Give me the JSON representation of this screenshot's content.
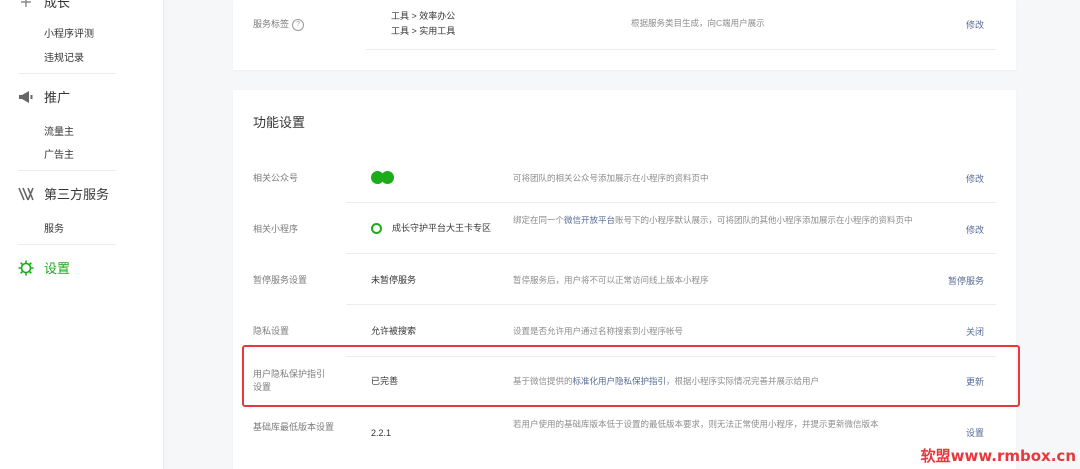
{
  "sidebar": {
    "group_growth": {
      "label": "成长",
      "items": [
        "小程序评测",
        "违规记录"
      ]
    },
    "group_promo": {
      "label": "推广",
      "items": [
        "流量主",
        "广告主"
      ]
    },
    "group_third": {
      "label": "第三方服务",
      "items": [
        "服务"
      ]
    },
    "group_settings": {
      "label": "设置"
    }
  },
  "top_card": {
    "row_label": "服务标签",
    "help": "?",
    "values": [
      "工具 > 效率办公",
      "工具 > 实用工具"
    ],
    "desc": "根据服务类目生成，向C端用户展示",
    "action": "修改"
  },
  "features": {
    "title": "功能设置",
    "rows": [
      {
        "label": "相关公众号",
        "value": "",
        "desc": "可将团队的相关公众号添加展示在小程序的资料页中",
        "action": "修改"
      },
      {
        "label": "相关小程序",
        "value": "成长守护平台大王卡专区",
        "desc_pre": "绑定在同一个",
        "desc_hl": "微信开放平台",
        "desc_post": "账号下的小程序默认展示，可将团队的其他小程序添加展示在小程序的资料页中",
        "action": "修改"
      },
      {
        "label": "暂停服务设置",
        "value": "未暂停服务",
        "desc": "暂停服务后，用户将不可以正常访问线上版本小程序",
        "action": "暂停服务"
      },
      {
        "label": "隐私设置",
        "value": "允许被搜索",
        "desc": "设置是否允许用户通过名称搜索到小程序帐号",
        "action": "关闭"
      },
      {
        "label": "用户隐私保护指引设置",
        "value": "已完善",
        "desc_pre": "基于微信提供的",
        "desc_hl": "标准化用户隐私保护指引",
        "desc_post": "，根据小程序实际情况完善并展示给用户",
        "action": "更新"
      },
      {
        "label": "基础库最低版本设置",
        "value": "2.2.1",
        "desc": "若用户使用的基础库版本低于设置的最低版本要求，则无法正常使用小程序，并提示更新微信版本",
        "action": "设置"
      }
    ]
  },
  "watermark": "软盟www.rmbox.cn",
  "colors": {
    "accent": "#1aad19",
    "link": "#576b95",
    "highlight_box": "#e6393e"
  }
}
